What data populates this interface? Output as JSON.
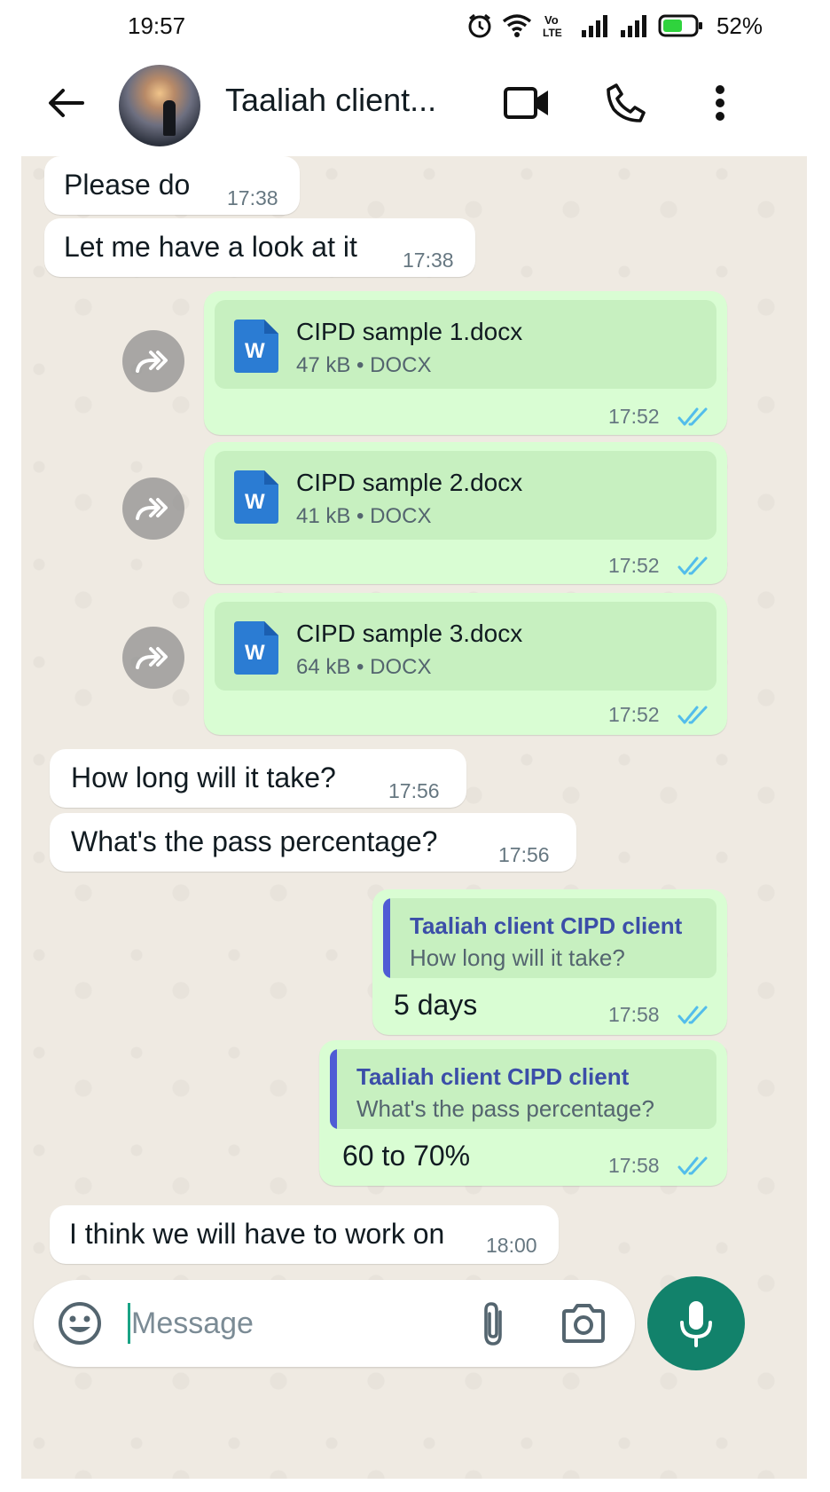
{
  "status_bar": {
    "time": "19:57",
    "battery_percent": "52%",
    "volte_label": "Vo LTE"
  },
  "header": {
    "contact_name": "Taaliah client..."
  },
  "messages": [
    {
      "direction": "incoming",
      "text": "Please do",
      "time": "17:38"
    },
    {
      "direction": "incoming",
      "text": "Let me have a look at it",
      "time": "17:38"
    },
    {
      "direction": "outgoing",
      "type": "document",
      "file_name": "CIPD sample 1.docx",
      "file_meta": "47 kB • DOCX",
      "icon_letter": "W",
      "time": "17:52",
      "status": "read"
    },
    {
      "direction": "outgoing",
      "type": "document",
      "file_name": "CIPD sample 2.docx",
      "file_meta": "41 kB • DOCX",
      "icon_letter": "W",
      "time": "17:52",
      "status": "read"
    },
    {
      "direction": "outgoing",
      "type": "document",
      "file_name": "CIPD sample 3.docx",
      "file_meta": "64 kB • DOCX",
      "icon_letter": "W",
      "time": "17:52",
      "status": "read"
    },
    {
      "direction": "incoming",
      "text": "How long will it take?",
      "time": "17:56"
    },
    {
      "direction": "incoming",
      "text": "What's the pass percentage?",
      "time": "17:56"
    },
    {
      "direction": "outgoing",
      "type": "reply",
      "quote_author": "Taaliah client CIPD client",
      "quote_text": "How long will it take?",
      "text": "5 days",
      "time": "17:58",
      "status": "read"
    },
    {
      "direction": "outgoing",
      "type": "reply",
      "quote_author": "Taaliah client CIPD client",
      "quote_text": "What's the pass percentage?",
      "text": "60 to 70%",
      "time": "17:58",
      "status": "read"
    },
    {
      "direction": "incoming",
      "text": "I think we will have to work on",
      "time": "18:00"
    }
  ],
  "composer": {
    "placeholder": "Message"
  },
  "colors": {
    "incoming_bubble": "#ffffff",
    "outgoing_bubble": "#d9fdd3",
    "chat_background": "#efeae2",
    "read_ticks": "#53bdeb",
    "accent_green": "#12826b",
    "quote_bar": "#4f5bd5",
    "word_icon": "#2b7cd3"
  },
  "icons": {
    "back": "arrow-left-icon",
    "video_call": "video-camera-icon",
    "voice_call": "phone-icon",
    "menu": "more-vertical-icon",
    "forward": "forward-icon",
    "document": "word-document-icon",
    "emoji": "emoji-icon",
    "attach": "paperclip-icon",
    "camera": "camera-icon",
    "mic": "microphone-icon"
  }
}
